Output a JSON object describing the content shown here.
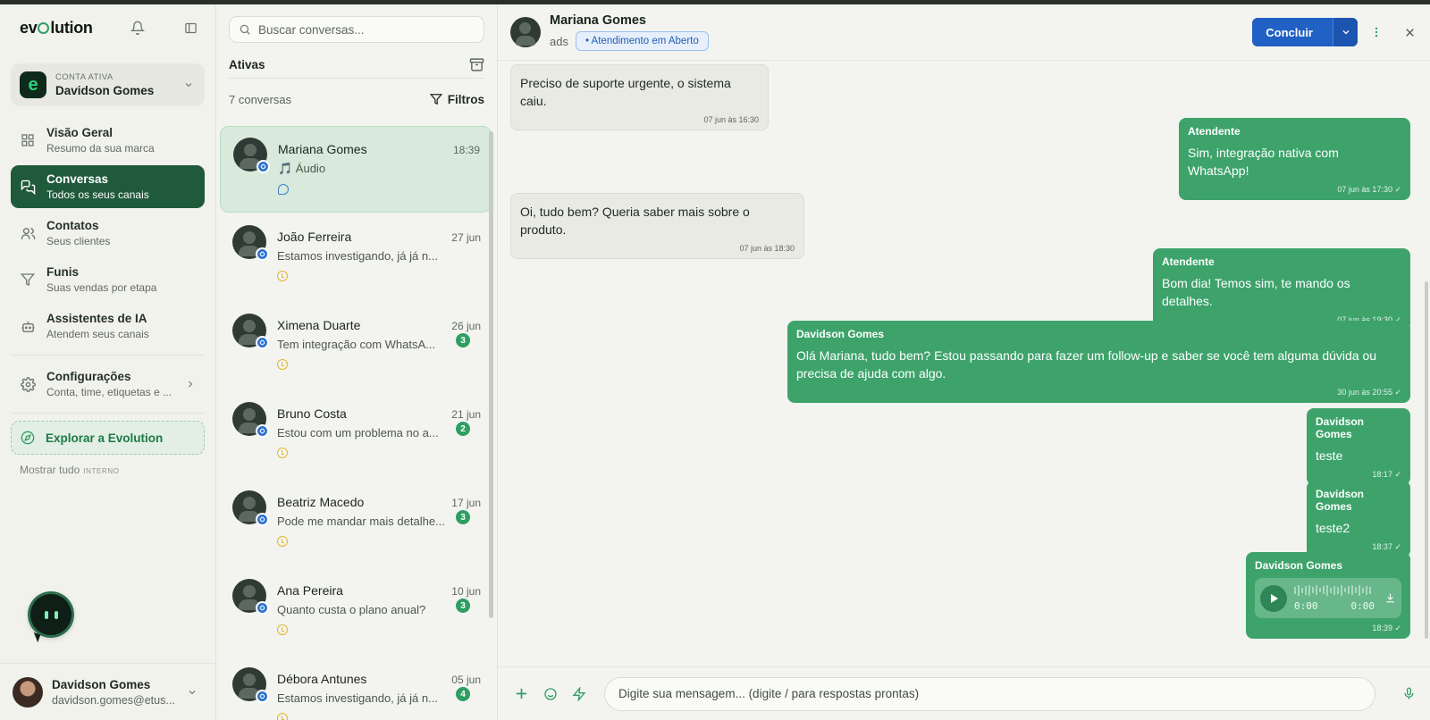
{
  "brand": {
    "name_prefix": "ev",
    "name_suffix": "lution"
  },
  "account": {
    "label": "CONTA ATIVA",
    "name": "Davidson Gomes",
    "logo_letter": "e"
  },
  "nav": [
    {
      "title": "Visão Geral",
      "subtitle": "Resumo da sua marca",
      "icon": "grid-icon"
    },
    {
      "title": "Conversas",
      "subtitle": "Todos os seus canais",
      "icon": "chat-icon",
      "active": true
    },
    {
      "title": "Contatos",
      "subtitle": "Seus clientes",
      "icon": "users-icon"
    },
    {
      "title": "Funis",
      "subtitle": "Suas vendas por etapa",
      "icon": "filter-icon"
    },
    {
      "title": "Assistentes de IA",
      "subtitle": "Atendem seus canais",
      "icon": "bot-icon"
    }
  ],
  "settings": {
    "title": "Configurações",
    "subtitle": "Conta, time, etiquetas e ..."
  },
  "explore": {
    "label": "Explorar a Evolution"
  },
  "show_all": {
    "label": "Mostrar tudo",
    "tag": "INTERNO"
  },
  "user": {
    "name": "Davidson Gomes",
    "email": "davidson.gomes@etus..."
  },
  "convlist": {
    "search_placeholder": "Buscar conversas...",
    "tab": "Ativas",
    "count": "7 conversas",
    "filters": "Filtros",
    "items": [
      {
        "name": "Mariana Gomes",
        "time": "18:39",
        "preview": "🎵 Áudio",
        "unread": "",
        "status": "blue"
      },
      {
        "name": "João Ferreira",
        "time": "27 jun",
        "preview": "Estamos investigando, já já n...",
        "unread": "",
        "status": "clock"
      },
      {
        "name": "Ximena Duarte",
        "time": "26 jun",
        "preview": "Tem integração com WhatsA...",
        "unread": "3",
        "status": "clock"
      },
      {
        "name": "Bruno Costa",
        "time": "21 jun",
        "preview": "Estou com um problema no a...",
        "unread": "2",
        "status": "clock"
      },
      {
        "name": "Beatriz Macedo",
        "time": "17 jun",
        "preview": "Pode me mandar mais detalhe...",
        "unread": "3",
        "status": "clock"
      },
      {
        "name": "Ana Pereira",
        "time": "10 jun",
        "preview": "Quanto custa o plano anual?",
        "unread": "3",
        "status": "clock"
      },
      {
        "name": "Débora Antunes",
        "time": "05 jun",
        "preview": "Estamos investigando, já já n...",
        "unread": "4",
        "status": "clock"
      }
    ]
  },
  "chat": {
    "contact_name": "Mariana Gomes",
    "source": "ads",
    "status_pill": "• Atendimento em Aberto",
    "conclude_label": "Concluir",
    "messages": [
      {
        "dir": "in",
        "author": "",
        "text": "Preciso de suporte urgente, o sistema caiu.",
        "meta": "07 jun às 16:30"
      },
      {
        "dir": "out",
        "author": "Atendente",
        "text": "Sim, integração nativa com WhatsApp!",
        "meta": "07 jun às 17:30 ✓"
      },
      {
        "dir": "in",
        "author": "",
        "text": "Oi, tudo bem? Queria saber mais sobre o produto.",
        "meta": "07 jun às 18:30"
      },
      {
        "dir": "out",
        "author": "Atendente",
        "text": "Bom dia! Temos sim, te mando os detalhes.",
        "meta": "07 jun às 19:30 ✓"
      },
      {
        "dir": "out",
        "author": "Davidson Gomes",
        "text": "Olá Mariana, tudo bem? Estou passando para fazer um follow-up e saber se você tem alguma dúvida ou precisa de ajuda com algo.",
        "meta": "30 jun às 20:55 ✓"
      },
      {
        "dir": "out",
        "author": "Davidson Gomes",
        "text": "teste",
        "meta": "18:17 ✓"
      },
      {
        "dir": "out",
        "author": "Davidson Gomes",
        "text": "teste2",
        "meta": "18:37 ✓"
      },
      {
        "dir": "out",
        "author": "Davidson Gomes",
        "text": "",
        "meta": "18:39 ✓",
        "audio": {
          "current": "0:00",
          "total": "0:00"
        }
      }
    ],
    "composer_placeholder": "Digite sua mensagem... (digite / para respostas prontas)"
  }
}
